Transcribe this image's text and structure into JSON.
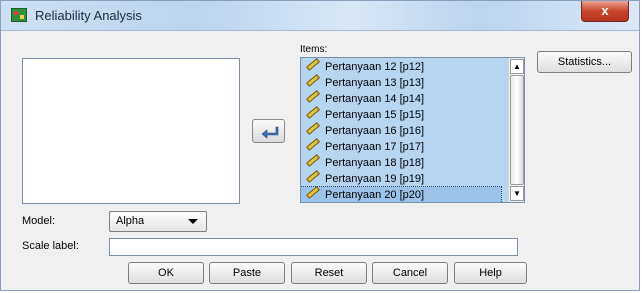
{
  "window": {
    "title": "Reliability Analysis",
    "close_label": "x"
  },
  "items": {
    "label": "Items:",
    "list": [
      "Pertanyaan 12 [p12]",
      "Pertanyaan 13 [p13]",
      "Pertanyaan 14 [p14]",
      "Pertanyaan 15 [p15]",
      "Pertanyaan 16 [p16]",
      "Pertanyaan 17 [p17]",
      "Pertanyaan 18 [p18]",
      "Pertanyaan 19 [p19]",
      "Pertanyaan 20 [p20]"
    ]
  },
  "buttons": {
    "statistics": "Statistics...",
    "ok": "OK",
    "paste": "Paste",
    "reset": "Reset",
    "cancel": "Cancel",
    "help": "Help"
  },
  "model": {
    "label": "Model:",
    "value": "Alpha"
  },
  "scale_label": {
    "label": "Scale label:",
    "value": ""
  },
  "colors": {
    "selection": "#b6d5f0",
    "title_bar": "#c9dcf1"
  }
}
